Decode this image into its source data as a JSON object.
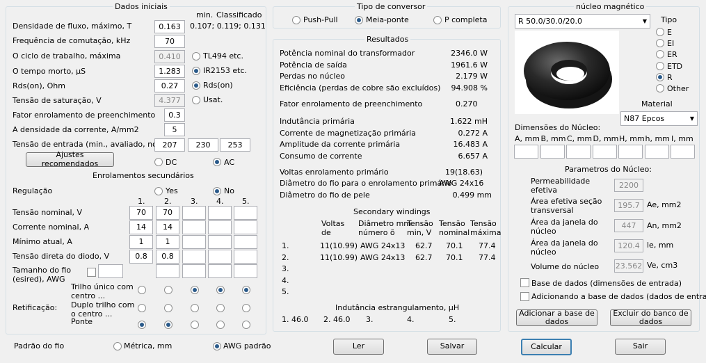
{
  "dados_iniciais": {
    "title": "Dados iniciais",
    "col_min": "min.",
    "col_class": "Classificado",
    "flux_label": "Densidade de fluxo, máximo, T",
    "flux_value": "0.163",
    "flux_ref": "0.107; 0.119; 0.131",
    "freq_label": "Frequência de comutação, kHz",
    "freq_value": "70",
    "duty_label": "O ciclo de trabalho, máxima",
    "duty_value": "0.410",
    "duty_opt": "TL494 etc.",
    "dead_label": "O tempo morto, µS",
    "dead_value": "1.283",
    "dead_opt": "IR2153 etc.",
    "rds_label": "Rds(on), Ohm",
    "rds_value": "0.27",
    "rds_opt": "Rds(on)",
    "sat_label": "Tensão de saturação, V",
    "sat_value": "4.377",
    "sat_opt": "Usat.",
    "fill_label": "Fator enrolamento de preenchimento",
    "fill_value": "0.3",
    "curd_label": "A densidade da corrente, A/mm2",
    "curd_value": "5",
    "vin_label": "Tensão de entrada (min., avaliado, no",
    "vin_min": "207",
    "vin_nom": "230",
    "vin_max": "253",
    "recommended_btn": "Ajustes recomendados",
    "dc": "DC",
    "ac": "AC"
  },
  "secundarios": {
    "title": "Enrolamentos secundários",
    "reg_label": "Regulação",
    "yes": "Yes",
    "no": "No",
    "cols": [
      "1.",
      "2.",
      "3.",
      "4.",
      "5."
    ],
    "rows": [
      {
        "label": "Tensão nominal, V",
        "values": [
          "70",
          "70",
          "",
          "",
          ""
        ]
      },
      {
        "label": "Corrente nominal, A",
        "values": [
          "14",
          "14",
          "",
          "",
          ""
        ]
      },
      {
        "label": "Mínimo atual, A",
        "values": [
          "1",
          "1",
          "",
          "",
          ""
        ]
      },
      {
        "label": "Tensão direta do diodo, V",
        "values": [
          "0.8",
          "0.8",
          "",
          "",
          ""
        ]
      }
    ],
    "wire_label_1": "Tamanho do fio",
    "wire_label_2": "(esired), AWG",
    "rect_label": "Retificação:",
    "rect_opts": [
      {
        "l1": "Trilho único com",
        "l2": "centro ...",
        "sel": [
          false,
          false,
          true,
          true,
          true
        ]
      },
      {
        "l1": "Duplo trilho com",
        "l2": "o centro ...",
        "sel": [
          false,
          false,
          false,
          false,
          false
        ]
      },
      {
        "l1": "Ponte",
        "l2": "",
        "sel": [
          true,
          true,
          false,
          false,
          false
        ]
      }
    ]
  },
  "footer": {
    "wire_std": "Padrão do fio",
    "metric": "Métrica, mm",
    "awg": "AWG padrão",
    "read": "Ler",
    "save": "Salvar",
    "calc": "Calcular",
    "exit": "Sair"
  },
  "conversor": {
    "title": "Tipo de conversor",
    "push": "Push-Pull",
    "half": "Meia-ponte",
    "full": "P completa"
  },
  "resultados": {
    "title": "Resultados",
    "lines": [
      {
        "label": "Potência nominal do transformador",
        "value": "2346.0 W"
      },
      {
        "label": "Potência de saída",
        "value": "1961.6 W"
      },
      {
        "label": "Perdas no núcleo",
        "value": "2.179 W"
      },
      {
        "label": "Eficiência (perdas de cobre são excluídos)",
        "value": "94.908 %"
      }
    ],
    "fill_label": "Fator enrolamento de preenchimento",
    "fill_value": "0.270",
    "lines2": [
      {
        "label": "Indutância primária",
        "value": "1.622 mH"
      },
      {
        "label": "Corrente de magnetização primária",
        "value": "0.272 A"
      },
      {
        "label": "Amplitude da corrente primária",
        "value": "16.483 A"
      },
      {
        "label": "Consumo de corrente",
        "value": "6.657 A"
      }
    ],
    "turns_label": "Voltas enrolamento primário",
    "turns_value": "19(18.63)",
    "diam_label": "Diâmetro do fio para o enrolamento primário",
    "diam_value": "AWG 24x16",
    "skin_label": "Diâmetro do fio de pele",
    "skin_value": "0.499 mm",
    "sec_title": "Secondary windings",
    "sec_h1": [
      "Voltas",
      "Diâmetro mm",
      "Tensão",
      "Tensão",
      "Tensão"
    ],
    "sec_h2": [
      "de",
      "número õ",
      "min, V",
      "nominal",
      "máxima"
    ],
    "sec_rows": [
      {
        "n": "1.",
        "t": "11(10.99)",
        "d": "AWG 24x13",
        "v1": "62.7",
        "v2": "70.1",
        "v3": "77.4"
      },
      {
        "n": "2.",
        "t": "11(10.99)",
        "d": "AWG 24x13",
        "v1": "62.7",
        "v2": "70.1",
        "v3": "77.4"
      },
      {
        "n": "3.",
        "t": "",
        "d": "",
        "v1": "",
        "v2": "",
        "v3": ""
      },
      {
        "n": "4.",
        "t": "",
        "d": "",
        "v1": "",
        "v2": "",
        "v3": ""
      },
      {
        "n": "5.",
        "t": "",
        "d": "",
        "v1": "",
        "v2": "",
        "v3": ""
      }
    ],
    "choke_title": "Indutância estrangulamento, µH",
    "choke": [
      "1. 46.0",
      "2. 46.0",
      "3.",
      "4.",
      "5."
    ]
  },
  "nucleo": {
    "title": "núcleo magnético",
    "core_select": "R 50.0/30.0/20.0",
    "tipo": "Tipo",
    "types": [
      {
        "l": "E",
        "on": false
      },
      {
        "l": "EI",
        "on": false
      },
      {
        "l": "ER",
        "on": false
      },
      {
        "l": "ETD",
        "on": false
      },
      {
        "l": "R",
        "on": true
      },
      {
        "l": "Other",
        "on": false
      }
    ],
    "material_label": "Material",
    "material": "N87 Epcos",
    "dims_title": "Dimensões do Núcleo:",
    "dims": [
      "A, mm",
      "B, mm",
      "C, mm",
      "D, mm",
      "H, mm",
      "h, mm",
      "I, mm"
    ],
    "params_title": "Parametros do Núcleo:",
    "perm_1": "Permeabilidade",
    "perm_2": "efetiva",
    "perm_value": "2200",
    "ae_1": "Área efetiva seção",
    "ae_2": "transversal",
    "ae_value": "195.7",
    "ae_unit": "Ae, mm2",
    "an_1": "Área da janela do",
    "an_2": "núcleo",
    "an_value": "447",
    "an_unit": "An, mm2",
    "le_1": "Área da janela do",
    "le_2": "núcleo",
    "le_value": "120.4",
    "le_unit": "le, mm",
    "ve_label": "Volume do núcleo",
    "ve_value": "23.562",
    "ve_unit": "Ve, cm3",
    "db1": "Base de dados (dimensões de entrada)",
    "db2": "Adicionando a base de dados (dados de entrada)",
    "add_btn_1": "Adicionar a base de",
    "add_btn_2": "dados",
    "del_btn_1": "Excluir do banco de",
    "del_btn_2": "dados"
  }
}
